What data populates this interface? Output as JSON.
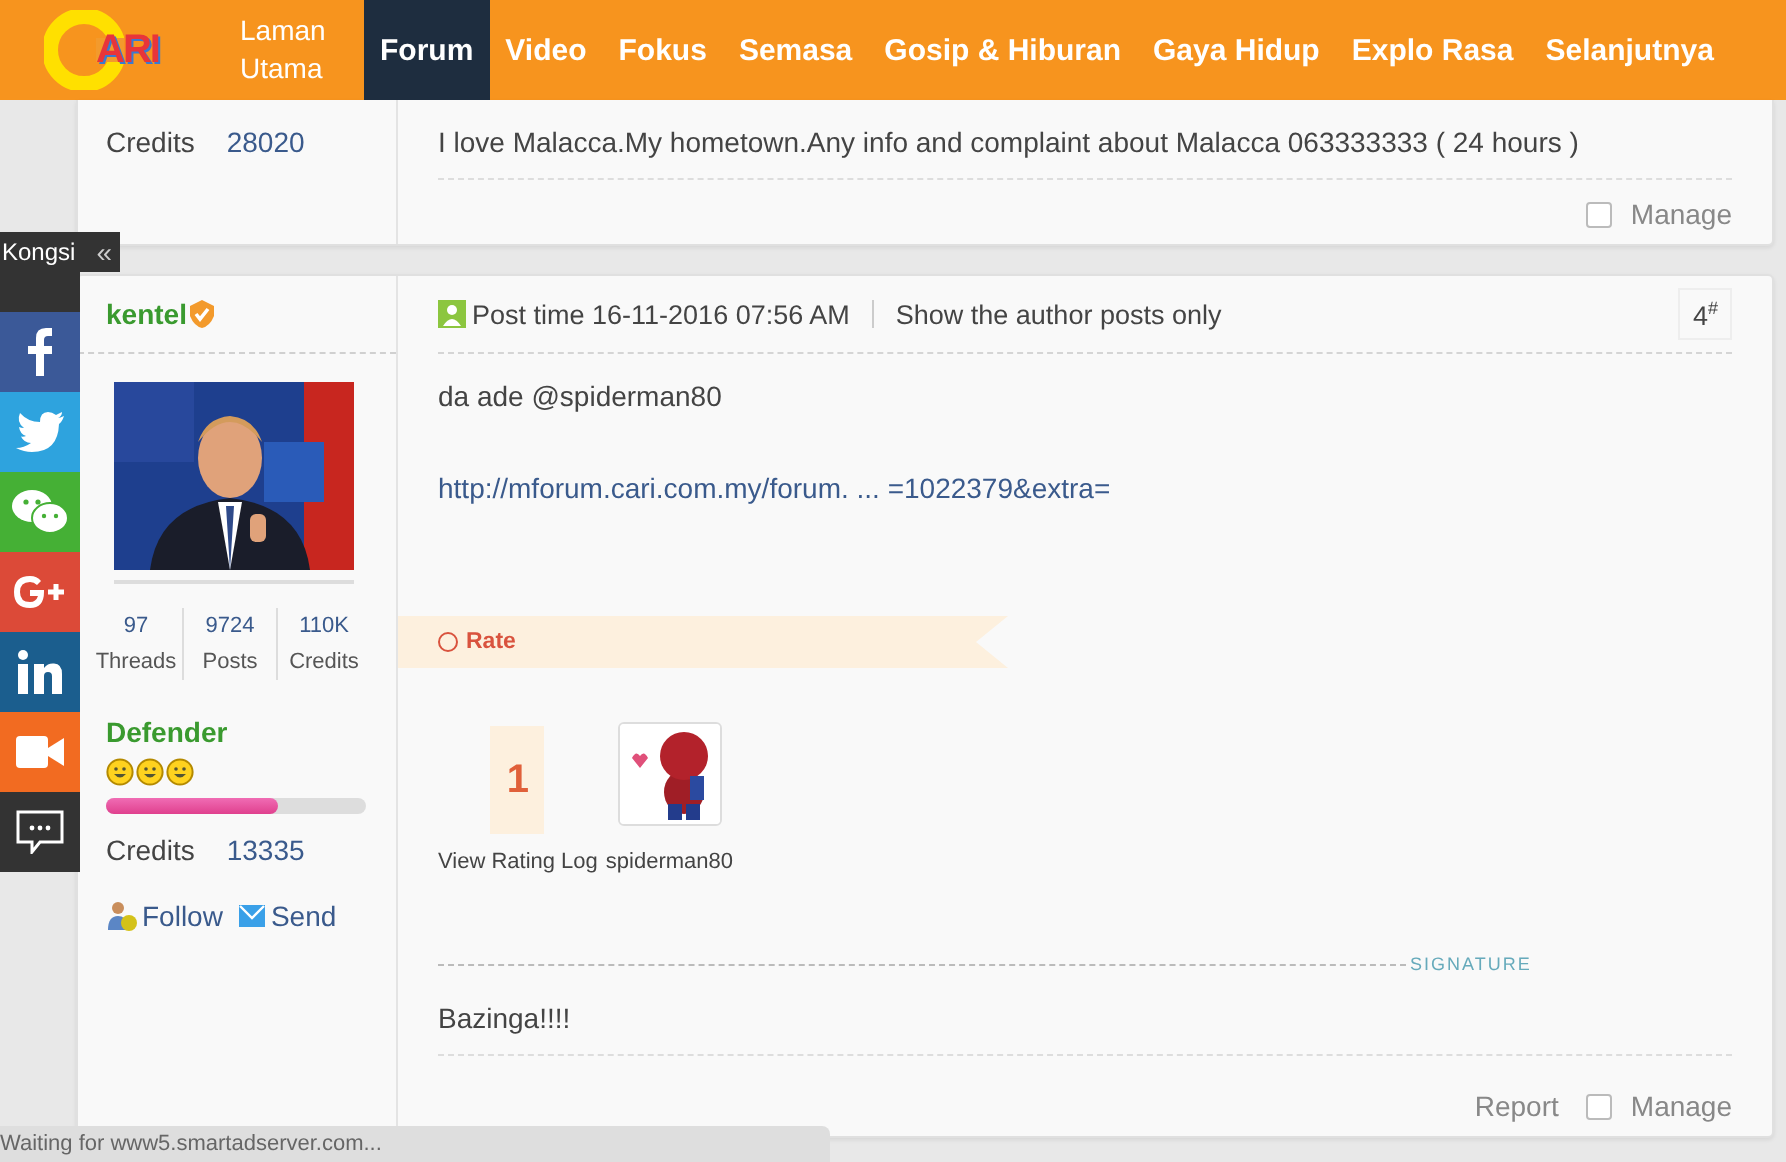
{
  "header": {
    "logo_text": "ARI",
    "nav": [
      {
        "label": "Laman Utama",
        "selected": false
      },
      {
        "label": "Forum",
        "selected": true
      },
      {
        "label": "Video",
        "selected": false
      },
      {
        "label": "Fokus",
        "selected": false
      },
      {
        "label": "Semasa",
        "selected": false
      },
      {
        "label": "Gosip & Hiburan",
        "selected": false
      },
      {
        "label": "Gaya Hidup",
        "selected": false
      },
      {
        "label": "Explo Rasa",
        "selected": false
      },
      {
        "label": "Selanjutnya",
        "selected": false
      }
    ]
  },
  "previous_post": {
    "credits_label": "Credits",
    "credits_value": "28020",
    "message": "I love Malacca.My hometown.Any info and complaint about Malacca 063333333 ( 24 hours )",
    "manage": {
      "label": "Manage",
      "checked": false
    }
  },
  "share_bar": {
    "label": "Kongsi",
    "collapse": "«",
    "buttons": [
      {
        "kind": "facebook",
        "color": "#3b5998"
      },
      {
        "kind": "twitter",
        "color": "#2ea3de"
      },
      {
        "kind": "wechat",
        "color": "#45b035"
      },
      {
        "kind": "googleplus",
        "color": "#dc4a38"
      },
      {
        "kind": "linkedin",
        "color": "#1b5e8e"
      },
      {
        "kind": "video",
        "color": "#f26b21"
      },
      {
        "kind": "comment",
        "color": "#333333"
      }
    ]
  },
  "post": {
    "author": {
      "name": "kentel",
      "verified": true,
      "stats": [
        {
          "value": "97",
          "label": "Threads"
        },
        {
          "value": "9724",
          "label": "Posts"
        },
        {
          "value": "110K",
          "label": "Credits"
        }
      ],
      "rank": "Defender",
      "stars": 3,
      "level": 0.66,
      "credits_label": "Credits",
      "credits_value": "13335",
      "actions": [
        {
          "kind": "follow",
          "label": "Follow"
        },
        {
          "kind": "send",
          "label": "Send"
        }
      ]
    },
    "post_time": "Post time 16-11-2016 07:56 AM",
    "author_only": "Show the author posts only",
    "number": "4",
    "number_mark": "#",
    "body": "da ade @spiderman80",
    "link": "http://mforum.cari.com.my/forum. ... =1022379&extra=",
    "rate_label": "Rate",
    "rating_count": "1",
    "rating_log": "View Rating Log",
    "rater": "spiderman80",
    "signature_label": "SIGNATURE",
    "signature": "Bazinga!!!!",
    "report": "Report",
    "manage": {
      "label": "Manage",
      "checked": false
    }
  },
  "status_bar": "Waiting for www5.smartadserver.com..."
}
